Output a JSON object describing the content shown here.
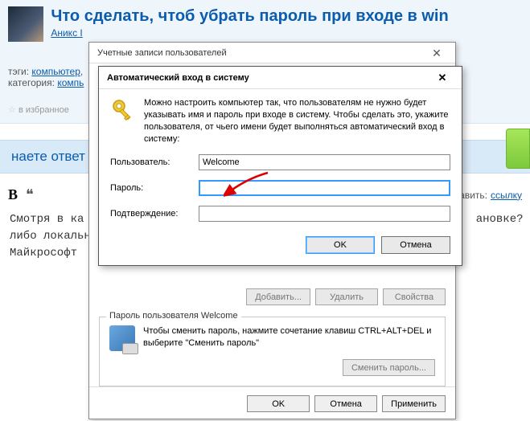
{
  "page": {
    "question_title": "Что сделать, чтоб убрать пароль при входе в win",
    "author": "Аникс I",
    "tags_label": "тэги:",
    "tag_computer": "компьютер",
    "category_label": "категория:",
    "category_value": "компь",
    "fav_label": "в избранное",
    "answer_header": "наете ответ",
    "toolbar_add": "добавить:",
    "toolbar_link": "ссылку",
    "answer_body": "Смотря в ка                                                          ановке? Учетна\nлибо локальн\nМайкрософт"
  },
  "outer": {
    "title": "Учетные записи пользователей",
    "btn_add": "Добавить...",
    "btn_remove": "Удалить",
    "btn_props": "Свойства",
    "group_title": "Пароль пользователя Welcome",
    "group_text": "Чтобы сменить пароль, нажмите сочетание клавиш CTRL+ALT+DEL и выберите \"Сменить пароль\"",
    "btn_change_pw": "Сменить пароль...",
    "btn_ok": "OK",
    "btn_cancel": "Отмена",
    "btn_apply": "Применить"
  },
  "inner": {
    "title": "Автоматический вход в систему",
    "desc": "Можно настроить компьютер так, что пользователям не нужно будет указывать имя и пароль при входе в систему. Чтобы сделать это, укажите пользователя, от чьего имени будет выполняться автоматический вход в систему:",
    "user_label": "Пользователь:",
    "user_value": "Welcome",
    "pw_label": "Пароль:",
    "confirm_label": "Подтверждение:",
    "btn_ok": "OK",
    "btn_cancel": "Отмена"
  }
}
